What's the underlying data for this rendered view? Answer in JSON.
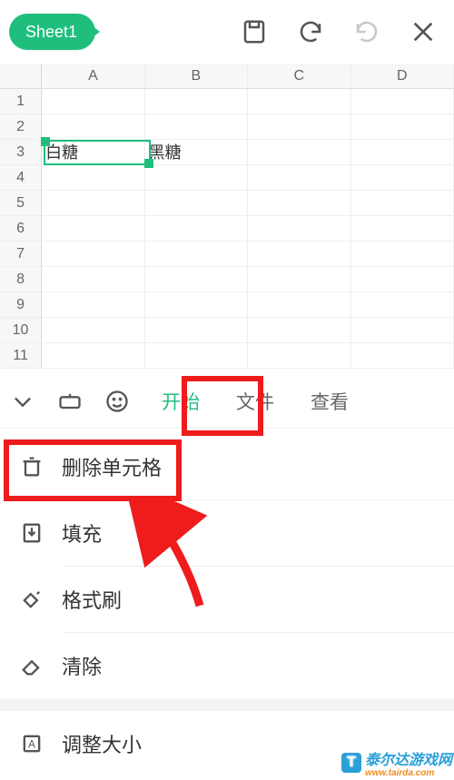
{
  "toolbar": {
    "sheet_name": "Sheet1"
  },
  "grid": {
    "columns": [
      "A",
      "B",
      "C",
      "D"
    ],
    "rows": [
      "1",
      "2",
      "3",
      "4",
      "5",
      "6",
      "7",
      "8",
      "9",
      "10",
      "11"
    ],
    "cells": {
      "A3": "白糖",
      "B3": "黑糖"
    },
    "selected": "A3"
  },
  "panel": {
    "tabs": {
      "start": "开始",
      "file": "文件",
      "view": "查看"
    },
    "menu": {
      "delete_cell": "删除单元格",
      "fill": "填充",
      "format_painter": "格式刷",
      "clear": "清除",
      "resize": "调整大小"
    }
  },
  "watermark": {
    "site": "泰尔达游戏网",
    "url": "www.tairda.com"
  }
}
